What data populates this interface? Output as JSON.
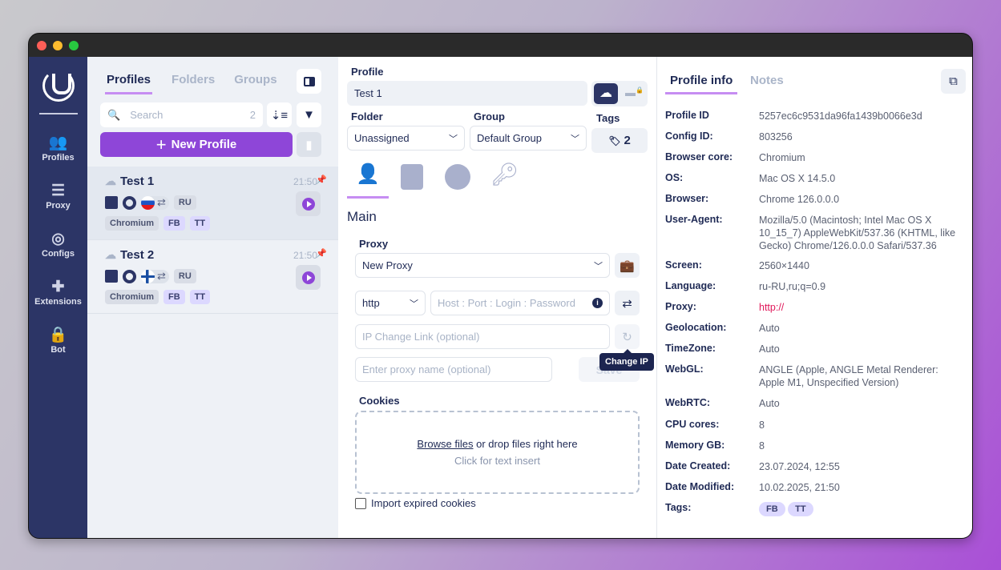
{
  "nav": {
    "items": [
      {
        "label": "Profiles",
        "icon": "users-gear-icon"
      },
      {
        "label": "Proxy",
        "icon": "server-icon"
      },
      {
        "label": "Configs",
        "icon": "fingerprint-icon"
      },
      {
        "label": "Extensions",
        "icon": "puzzle-icon"
      },
      {
        "label": "Bot",
        "icon": "lock-icon"
      }
    ]
  },
  "list": {
    "tabs": [
      "Profiles",
      "Folders",
      "Groups"
    ],
    "search_placeholder": "Search",
    "count": "2",
    "new_profile": "New Profile",
    "profiles": [
      {
        "name": "Test 1",
        "time": "21:50",
        "country": "RU",
        "flag": "russia",
        "tags": [
          "Chromium",
          "FB",
          "TT"
        ]
      },
      {
        "name": "Test 2",
        "time": "21:50",
        "country": "RU",
        "flag": "finland",
        "tags": [
          "Chromium",
          "FB",
          "TT"
        ]
      }
    ]
  },
  "main": {
    "profile_label": "Profile",
    "profile_value": "Test 1",
    "folder_label": "Folder",
    "folder_value": "Unassigned",
    "group_label": "Group",
    "group_value": "Default Group",
    "tags_label": "Tags",
    "tags_count": "2",
    "section": "Main",
    "proxy_label": "Proxy",
    "proxy_value": "New Proxy",
    "protocol": "http",
    "host_placeholder": "Host : Port : Login : Password",
    "ip_change_placeholder": "IP Change Link (optional)",
    "proxy_name_placeholder": "Enter proxy name (optional)",
    "save": "Save",
    "tooltip": "Change IP",
    "cookies_label": "Cookies",
    "browse": "Browse files",
    "drop_text": "or drop files right here",
    "click_text": "Click for text insert",
    "import_expired": "Import expired cookies"
  },
  "info": {
    "tabs": [
      "Profile info",
      "Notes"
    ],
    "rows": [
      {
        "k": "Profile ID",
        "v": "5257ec6c9531da96fa1439b0066e3d"
      },
      {
        "k": "Config ID:",
        "v": "803256"
      },
      {
        "k": "Browser core:",
        "v": "Chromium"
      },
      {
        "k": "OS:",
        "v": "Mac OS X 14.5.0"
      },
      {
        "k": "Browser:",
        "v": "Chrome 126.0.0.0"
      },
      {
        "k": "User-Agent:",
        "v": "Mozilla/5.0 (Macintosh; Intel Mac OS X 10_15_7) AppleWebKit/537.36 (KHTML, like Gecko) Chrome/126.0.0.0 Safari/537.36"
      },
      {
        "k": "Screen:",
        "v": "2560×1440"
      },
      {
        "k": "Language:",
        "v": "ru-RU,ru;q=0.9"
      },
      {
        "k": "Proxy:",
        "v": "http://"
      },
      {
        "k": "Geolocation:",
        "v": "Auto"
      },
      {
        "k": "TimeZone:",
        "v": "Auto"
      },
      {
        "k": "WebGL:",
        "v": "ANGLE (Apple, ANGLE Metal Renderer: Apple M1, Unspecified Version)"
      },
      {
        "k": "WebRTC:",
        "v": "Auto"
      },
      {
        "k": "CPU cores:",
        "v": "8"
      },
      {
        "k": "Memory GB:",
        "v": "8"
      },
      {
        "k": "Date Created:",
        "v": "23.07.2024, 12:55"
      },
      {
        "k": "Date Modified:",
        "v": "10.02.2025, 21:50"
      },
      {
        "k": "Tags:",
        "v": ""
      }
    ],
    "tags": [
      "FB",
      "TT"
    ]
  },
  "colors": {
    "accent": "#8e46d8",
    "nav": "#2c3566",
    "proxy_value": "#e0185a"
  }
}
